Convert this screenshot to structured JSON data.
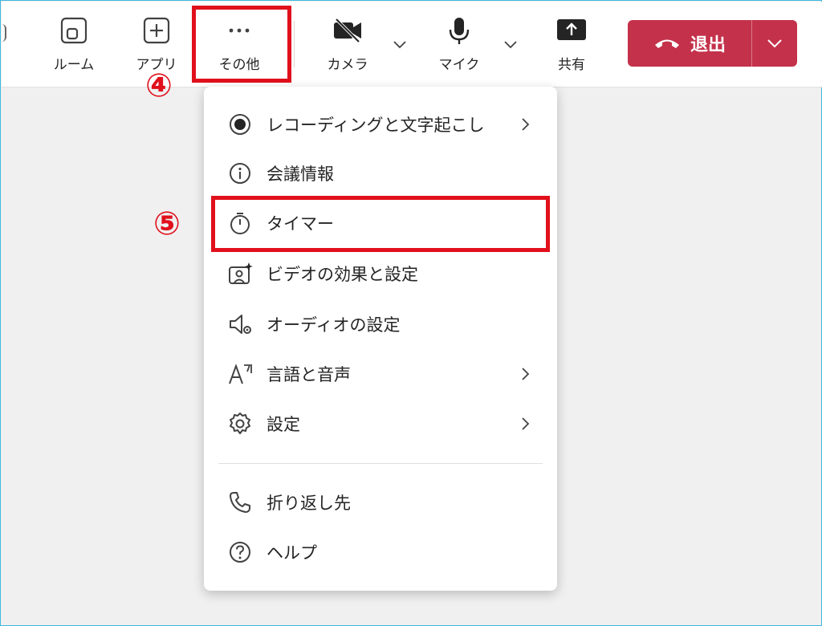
{
  "toolbar": {
    "items": [
      {
        "label": "ルーム",
        "icon": "room-icon"
      },
      {
        "label": "アプリ",
        "icon": "apps-icon"
      },
      {
        "label": "その他",
        "icon": "more-icon"
      },
      {
        "label": "カメラ",
        "icon": "camera-off-icon"
      },
      {
        "label": "マイク",
        "icon": "microphone-icon"
      },
      {
        "label": "共有",
        "icon": "share-icon"
      }
    ],
    "leave_label": "退出"
  },
  "annotations": {
    "step4": "④",
    "step5": "⑤"
  },
  "menu": {
    "items": [
      {
        "label": "レコーディングと文字起こし",
        "icon": "record-icon",
        "submenu": true
      },
      {
        "label": "会議情報",
        "icon": "info-icon",
        "submenu": false
      },
      {
        "label": "タイマー",
        "icon": "timer-icon",
        "submenu": false
      },
      {
        "label": "ビデオの効果と設定",
        "icon": "video-effects-icon",
        "submenu": false
      },
      {
        "label": "オーディオの設定",
        "icon": "audio-settings-icon",
        "submenu": false
      },
      {
        "label": "言語と音声",
        "icon": "language-icon",
        "submenu": true
      },
      {
        "label": "設定",
        "icon": "gear-icon",
        "submenu": true
      },
      {
        "label": "折り返し先",
        "icon": "phone-icon",
        "submenu": false
      },
      {
        "label": "ヘルプ",
        "icon": "help-icon",
        "submenu": false
      }
    ]
  },
  "colors": {
    "leave_button": "#c4314b",
    "highlight": "#e0101c",
    "frame": "#3fb8e0"
  }
}
